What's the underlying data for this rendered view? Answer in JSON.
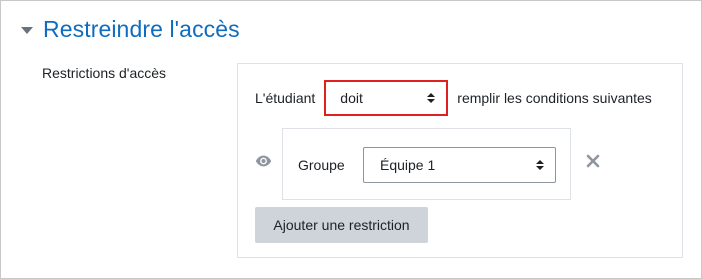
{
  "section": {
    "title": "Restreindre l'accès",
    "collapse_icon": "caret-down-icon"
  },
  "field": {
    "label": "Restrictions d'accès"
  },
  "availability": {
    "prefix": "L'étudiant",
    "must_select": {
      "value": "doit",
      "icon": "up-down-arrows-icon"
    },
    "suffix": "remplir les conditions suivantes"
  },
  "condition": {
    "eye_icon": "eye-icon",
    "type_label": "Groupe",
    "group_select": {
      "value": "Équipe 1",
      "icon": "up-down-arrows-icon"
    },
    "delete_icon": "close-icon"
  },
  "add_restriction_label": "Ajouter une restriction",
  "colors": {
    "title": "#0f6cbf",
    "highlight": "#e02020",
    "button_bg": "#ced4da"
  }
}
